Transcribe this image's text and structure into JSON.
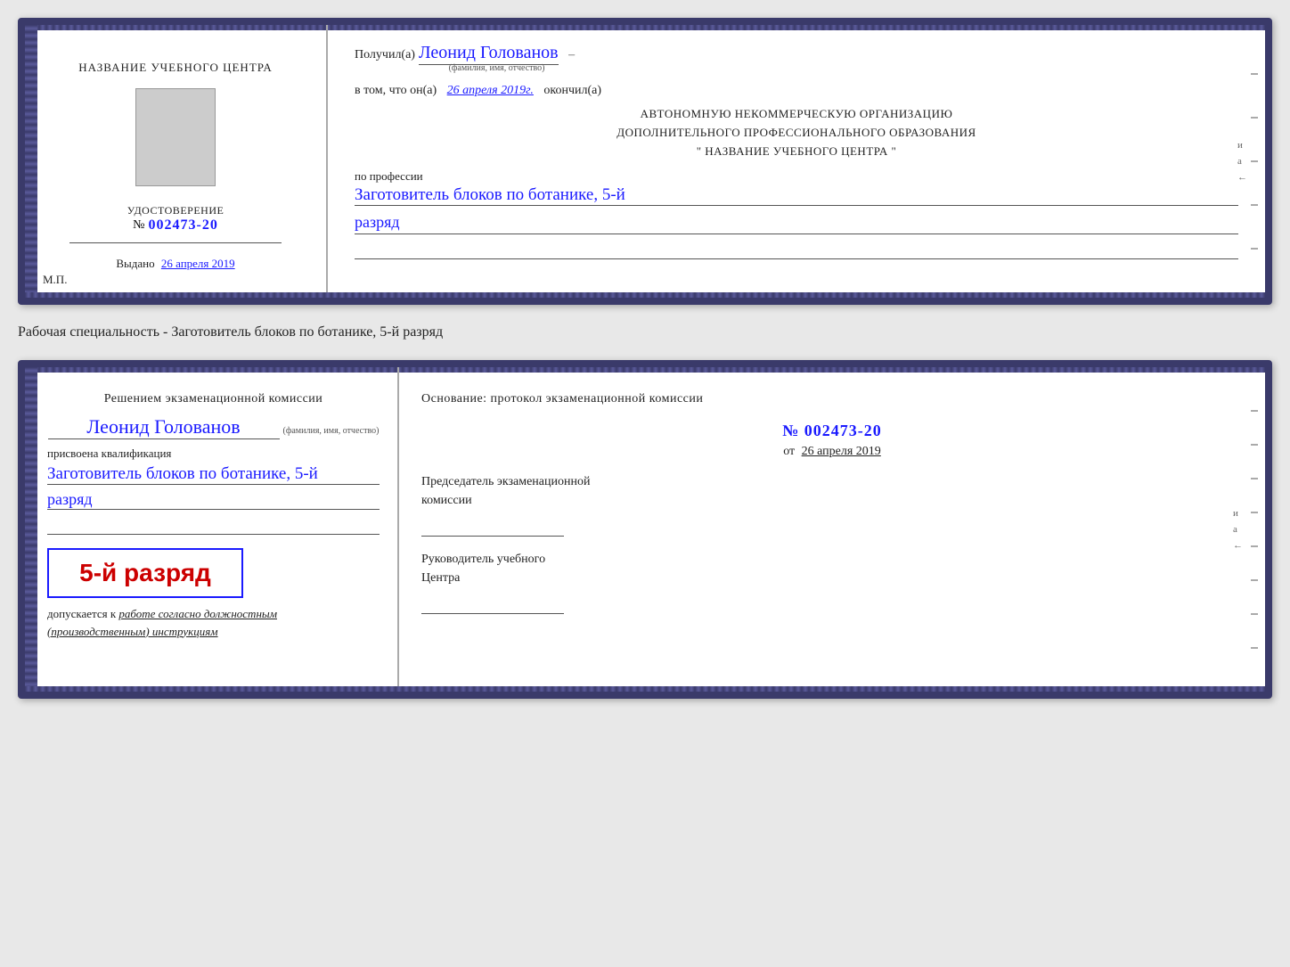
{
  "page": {
    "background": "#e8e8e8"
  },
  "card1": {
    "left": {
      "title_line1": "НАЗВАНИЕ УЧЕБНОГО ЦЕНТРА",
      "cert_label": "УДОСТОВЕРЕНИЕ",
      "cert_prefix": "№",
      "cert_number": "002473-20",
      "issued_label": "Выдано",
      "issued_date": "26 апреля 2019",
      "mp_label": "М.П."
    },
    "right": {
      "recipient_prefix": "Получил(а)",
      "recipient_name": "Леонид Голованов",
      "recipient_field_note": "(фамилия, имя, отчество)",
      "vtom_text": "в том, что он(а)",
      "vtom_date": "26 апреля 2019г.",
      "okончил": "окончил(а)",
      "org_line1": "АВТОНОМНУЮ НЕКОММЕРЧЕСКУЮ ОРГАНИЗАЦИЮ",
      "org_line2": "ДОПОЛНИТЕЛЬНОГО ПРОФЕССИОНАЛЬНОГО ОБРАЗОВАНИЯ",
      "org_line3": "\"  НАЗВАНИЕ УЧЕБНОГО ЦЕНТРА  \"",
      "profession_label": "по профессии",
      "profession_name": "Заготовитель блоков по ботанике, 5-й",
      "rank_handwritten": "разряд"
    }
  },
  "specialty_label": "Рабочая специальность - Заготовитель блоков по ботанике, 5-й разряд",
  "card2": {
    "left": {
      "decision_text": "Решением экзаменационной комиссии",
      "name_handwritten": "Леонид Голованов",
      "name_note": "(фамилия, имя, отчество)",
      "assigned_label": "присвоена квалификация",
      "qualification_name": "Заготовитель блоков по ботанике, 5-й",
      "rank_handwritten": "разряд",
      "grade_display": "5-й разряд",
      "admission_text1": "допускается к",
      "admission_italic": "работе согласно должностным",
      "admission_italic2": "(производственным) инструкциям"
    },
    "right": {
      "basis_text": "Основание: протокол экзаменационной комиссии",
      "protocol_prefix": "№",
      "protocol_number": "002473-20",
      "date_prefix": "от",
      "date_value": "26 апреля 2019",
      "chairman_label1": "Председатель экзаменационной",
      "chairman_label2": "комиссии",
      "director_label1": "Руководитель учебного",
      "director_label2": "Центра"
    }
  }
}
